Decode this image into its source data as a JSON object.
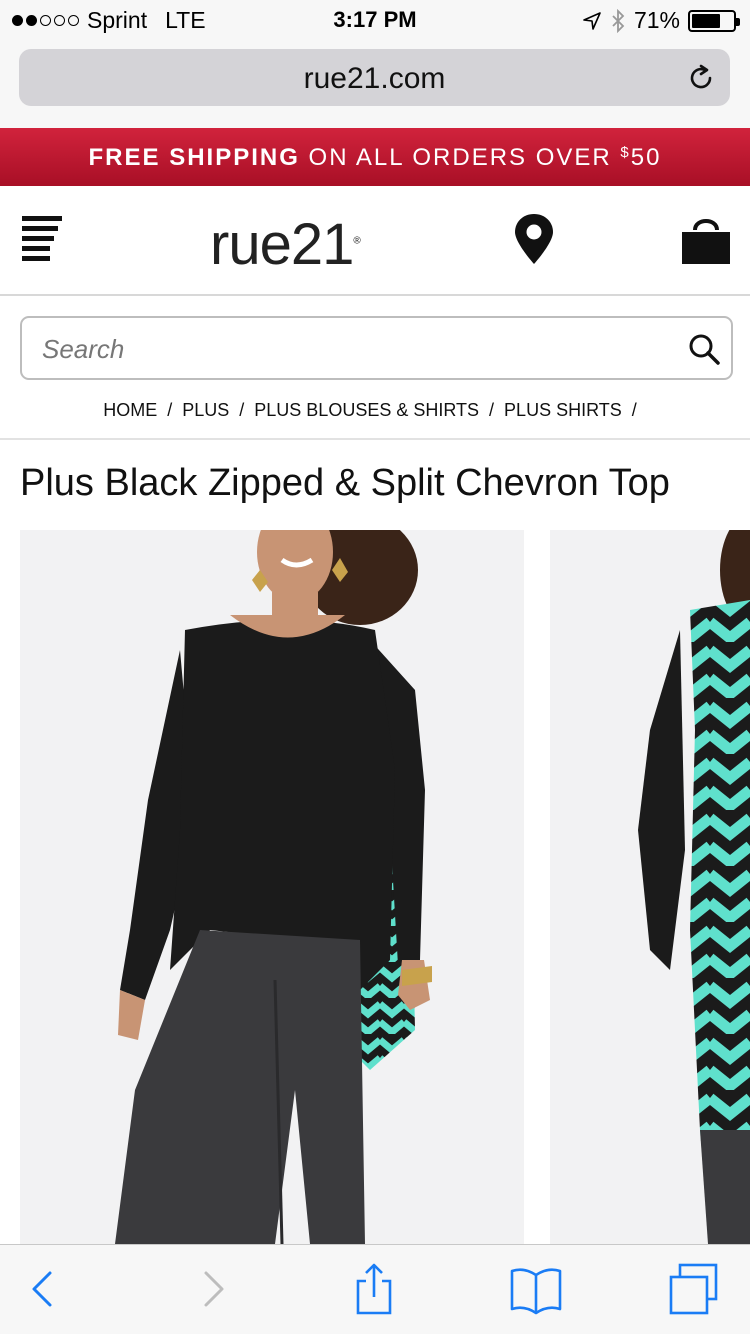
{
  "status_bar": {
    "carrier": "Sprint",
    "network": "LTE",
    "time": "3:17 PM",
    "battery": "71%",
    "battery_level": 0.71,
    "signal_bars_filled": 2,
    "signal_bars_total": 5
  },
  "browser": {
    "url": "rue21.com",
    "reload_icon": "reload-icon"
  },
  "promo": {
    "bold": "FREE SHIPPING",
    "rest": " ON ALL ORDERS OVER ",
    "currency": "$",
    "amount": "50"
  },
  "header": {
    "logo_text": "rue21",
    "logo_mark": "®",
    "icons": [
      "menu-icon",
      "location-pin-icon",
      "shopping-bag-icon"
    ]
  },
  "search": {
    "placeholder": "Search",
    "value": ""
  },
  "breadcrumb": {
    "items": [
      "HOME",
      "PLUS",
      "PLUS BLOUSES & SHIRTS",
      "PLUS SHIRTS"
    ],
    "separator": "/"
  },
  "product": {
    "title": "Plus Black Zipped & Split Chevron Top",
    "images": [
      "front-view",
      "back-view"
    ]
  },
  "toolbar": {
    "icons": [
      "back-chevron-icon",
      "forward-chevron-icon",
      "share-icon",
      "bookmarks-icon",
      "tabs-icon"
    ]
  },
  "colors": {
    "promo_red": "#c11a32",
    "ios_blue": "#1a7cf5",
    "chevron_teal": "#5fe0cc",
    "top_black": "#1b1b1b"
  }
}
